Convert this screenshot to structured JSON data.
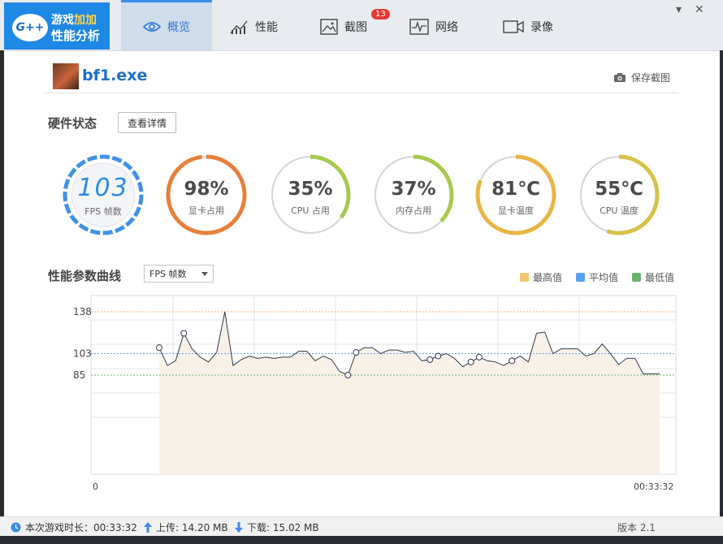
{
  "app": {
    "logo_badge": "G++",
    "logo_line1a": "游戏",
    "logo_line1b": "加加",
    "logo_line2": "性能分析"
  },
  "tabs": [
    {
      "label": "概览",
      "icon": "eye-icon",
      "active": true
    },
    {
      "label": "性能",
      "icon": "bar-chart-icon",
      "active": false
    },
    {
      "label": "截图",
      "icon": "picture-icon",
      "active": false,
      "badge": "13"
    },
    {
      "label": "网络",
      "icon": "network-icon",
      "active": false
    },
    {
      "label": "录像",
      "icon": "video-camera-icon",
      "active": false
    }
  ],
  "window_controls": {
    "menu": "▾",
    "close": "✕"
  },
  "header": {
    "process_name": "bf1.exe",
    "save_label": "保存截图"
  },
  "hardware": {
    "title": "硬件状态",
    "details_button": "查看详情",
    "fps": {
      "value": "103",
      "label": "FPS 帧数"
    },
    "gauges": [
      {
        "value": "98%",
        "label": "显卡占用",
        "fraction": 0.98,
        "color": "#e6803b"
      },
      {
        "value": "35%",
        "label": "CPU 占用",
        "fraction": 0.35,
        "color": "#a7c94f"
      },
      {
        "value": "37%",
        "label": "内存占用",
        "fraction": 0.37,
        "color": "#a7c94f"
      },
      {
        "value": "81℃",
        "label": "显卡温度",
        "fraction": 0.81,
        "color": "#e9b545"
      },
      {
        "value": "55℃",
        "label": "CPU 温度",
        "fraction": 0.55,
        "color": "#d6c24a"
      }
    ]
  },
  "curve": {
    "title": "性能参数曲线",
    "metric_selected": "FPS 帧数",
    "legend": [
      {
        "label": "最高值",
        "color": "#f0c66e"
      },
      {
        "label": "平均值",
        "color": "#5aa0ee"
      },
      {
        "label": "最低值",
        "color": "#6ab36e"
      }
    ]
  },
  "chart_data": {
    "type": "line",
    "ytick_labels": [
      "138",
      "103",
      "85"
    ],
    "max": 138,
    "avg": 103,
    "min": 85,
    "x_start_label": "0",
    "x_end_label": "00:33:32",
    "y": [
      108,
      93,
      97,
      120,
      107,
      100,
      96,
      104,
      138,
      93,
      98,
      101,
      99,
      100,
      99,
      100,
      100,
      105,
      105,
      97,
      101,
      98,
      88,
      85,
      104,
      108,
      108,
      103,
      106,
      106,
      104,
      105,
      97,
      98,
      101,
      103,
      99,
      92,
      96,
      100,
      97,
      96,
      93,
      97,
      101,
      96,
      120,
      121,
      103,
      107,
      107,
      107,
      101,
      103,
      111,
      103,
      94,
      99,
      99,
      86,
      86,
      86
    ],
    "markers": [
      0,
      3,
      23,
      24,
      33,
      34,
      38,
      39,
      43
    ]
  },
  "status": {
    "duration_label": "本次游戏时长：00:33:32",
    "upload_label": "上传: 14.20 MB",
    "download_label": "下载: 15.02 MB",
    "right_text": "版本 2.1"
  }
}
